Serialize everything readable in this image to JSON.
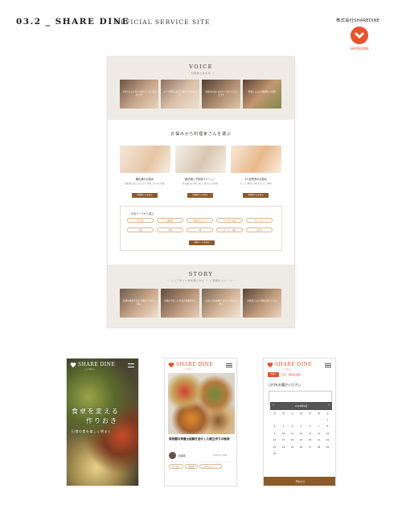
{
  "header": {
    "title": "03.2 _ SHARE DINE",
    "subtitle": "OFFICIAL SERVICE SITE",
    "company": "株式会社SHAREDINE",
    "logo_text": "SHAREDINE"
  },
  "desktop": {
    "voice_heading": "VOICE",
    "voice_sub": "ー 利用者さまの声 ー",
    "voice_cards": [
      "子供たちもパクパク食べてくれ 大満足です!",
      "スープ料理も喜んで 食べてくれました",
      "家族の好みに合わせて 作ってもらえます",
      "野菜たっぷりの料理に 大満足"
    ],
    "mid_heading": "お悩みから料理家さんを選ぶ",
    "categories": [
      {
        "title": "離乳食のお悩み",
        "desc": "離乳食に悩んでいる方へ 月齢に合わせた料理",
        "button": "料理家さんを見る"
      },
      {
        "title": "食が細い子供向けメニュー",
        "desc": "食の細いお子様に 楽しく食べられる料理",
        "button": "料理家さんを見る"
      },
      {
        "title": "3人目育児のお悩み",
        "desc": "忙しいご家庭に 時短でおいしい料理",
        "button": "料理家さんを見る"
      }
    ],
    "theme_heading": "お気テーマから選ぶ",
    "theme_tags": [
      "作り置き",
      "離乳食",
      "子供向けメニュー",
      "アレルギー対応",
      "ダイエット",
      "和食",
      "洋食",
      "中華",
      "パーティー料理",
      "お弁当"
    ],
    "theme_button": "検索テーマを見る",
    "story_heading": "STORY",
    "story_sub": "ー シェアダインを利用された ー ご家族のストーリー",
    "story_cards": [
      "産後の体調不良で 家事ができない時に",
      "共働きで忙しい 毎日の食事作りに",
      "子供たちの食事を 安心して任せられる",
      "家族団らんの 時間が増えました"
    ]
  },
  "phone1": {
    "logo": "SHARE DINE",
    "logo_sub": "シェアダイン",
    "hero_line1": "食卓を変える",
    "hero_line2": "作りおき",
    "hero_line3": "日常の食を楽しく明るく"
  },
  "phone2": {
    "logo": "SHARE DINE",
    "logo_sub": "シェアダイン",
    "article_title": "保育園の栄養士経験を活かした献立作りの秘訣",
    "author": "料理家",
    "date": "12/05/21 1000",
    "tags": [
      "作り置き",
      "離乳食",
      "子供向けメニュー"
    ]
  },
  "phone3": {
    "logo": "SHARE DINE",
    "logo_sub": "シェアダイン",
    "step_badge": "Step1",
    "step_label": "日付・時間を選択",
    "prompt": "日付をお選びください",
    "month": "2018年9月",
    "weekdays": [
      "日",
      "月",
      "火",
      "水",
      "木",
      "金",
      "土"
    ],
    "days": [
      "",
      "",
      "",
      "",
      "",
      "",
      "1",
      "2",
      "3",
      "4",
      "5",
      "6",
      "7",
      "8",
      "9",
      "10",
      "11",
      "12",
      "13",
      "14",
      "15",
      "16",
      "17",
      "18",
      "19",
      "20",
      "21",
      "22",
      "23",
      "24",
      "25",
      "26",
      "27",
      "28",
      "29",
      "30",
      "",
      "",
      "",
      "",
      "",
      ""
    ],
    "next_button": "予約する"
  }
}
